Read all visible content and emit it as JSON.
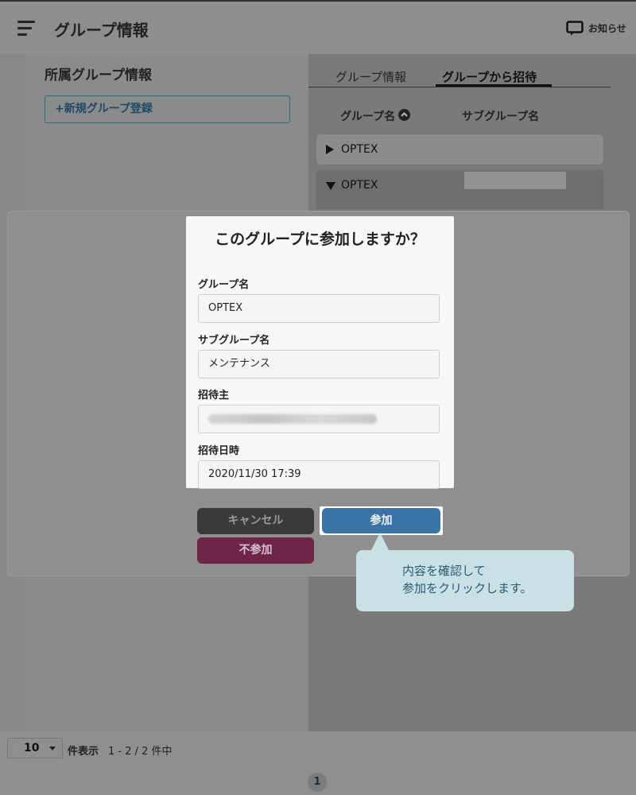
{
  "header": {
    "title": "グループ情報",
    "notice_label": "お知らせ"
  },
  "left_panel": {
    "title": "所属グループ情報",
    "new_group_button": "+新規グループ登録"
  },
  "tabs": [
    {
      "label": "グループ情報",
      "active": false
    },
    {
      "label": "グループから招待",
      "active": true
    }
  ],
  "table": {
    "columns": [
      "グループ名",
      "サブグループ名"
    ],
    "rows": [
      {
        "expanded": false,
        "group": "OPTEX"
      },
      {
        "expanded": true,
        "group": "OPTEX"
      }
    ]
  },
  "dialog": {
    "title": "このグループに参加しますか？",
    "fields": [
      {
        "label": "グループ名",
        "value": "OPTEX"
      },
      {
        "label": "サブグループ名",
        "value": "メンテナンス"
      },
      {
        "label": "招待主",
        "value": ""
      },
      {
        "label": "招待日時",
        "value": "2020/11/30 17:39"
      }
    ],
    "buttons": {
      "cancel": "キャンセル",
      "join": "参加",
      "decline": "不参加"
    }
  },
  "callout": {
    "line1": "内容を確認して",
    "line2": "参加をクリックします。"
  },
  "footer": {
    "per_page_value": "10",
    "per_page_label": "件表示",
    "range_label": "1 - 2 / 2 件中",
    "current_page": "1"
  },
  "colors": {
    "join_button": "#3a74a6",
    "decline_button": "#6e2547",
    "cancel_button": "#3a3a3a",
    "callout_bg": "#c9e1e5"
  }
}
